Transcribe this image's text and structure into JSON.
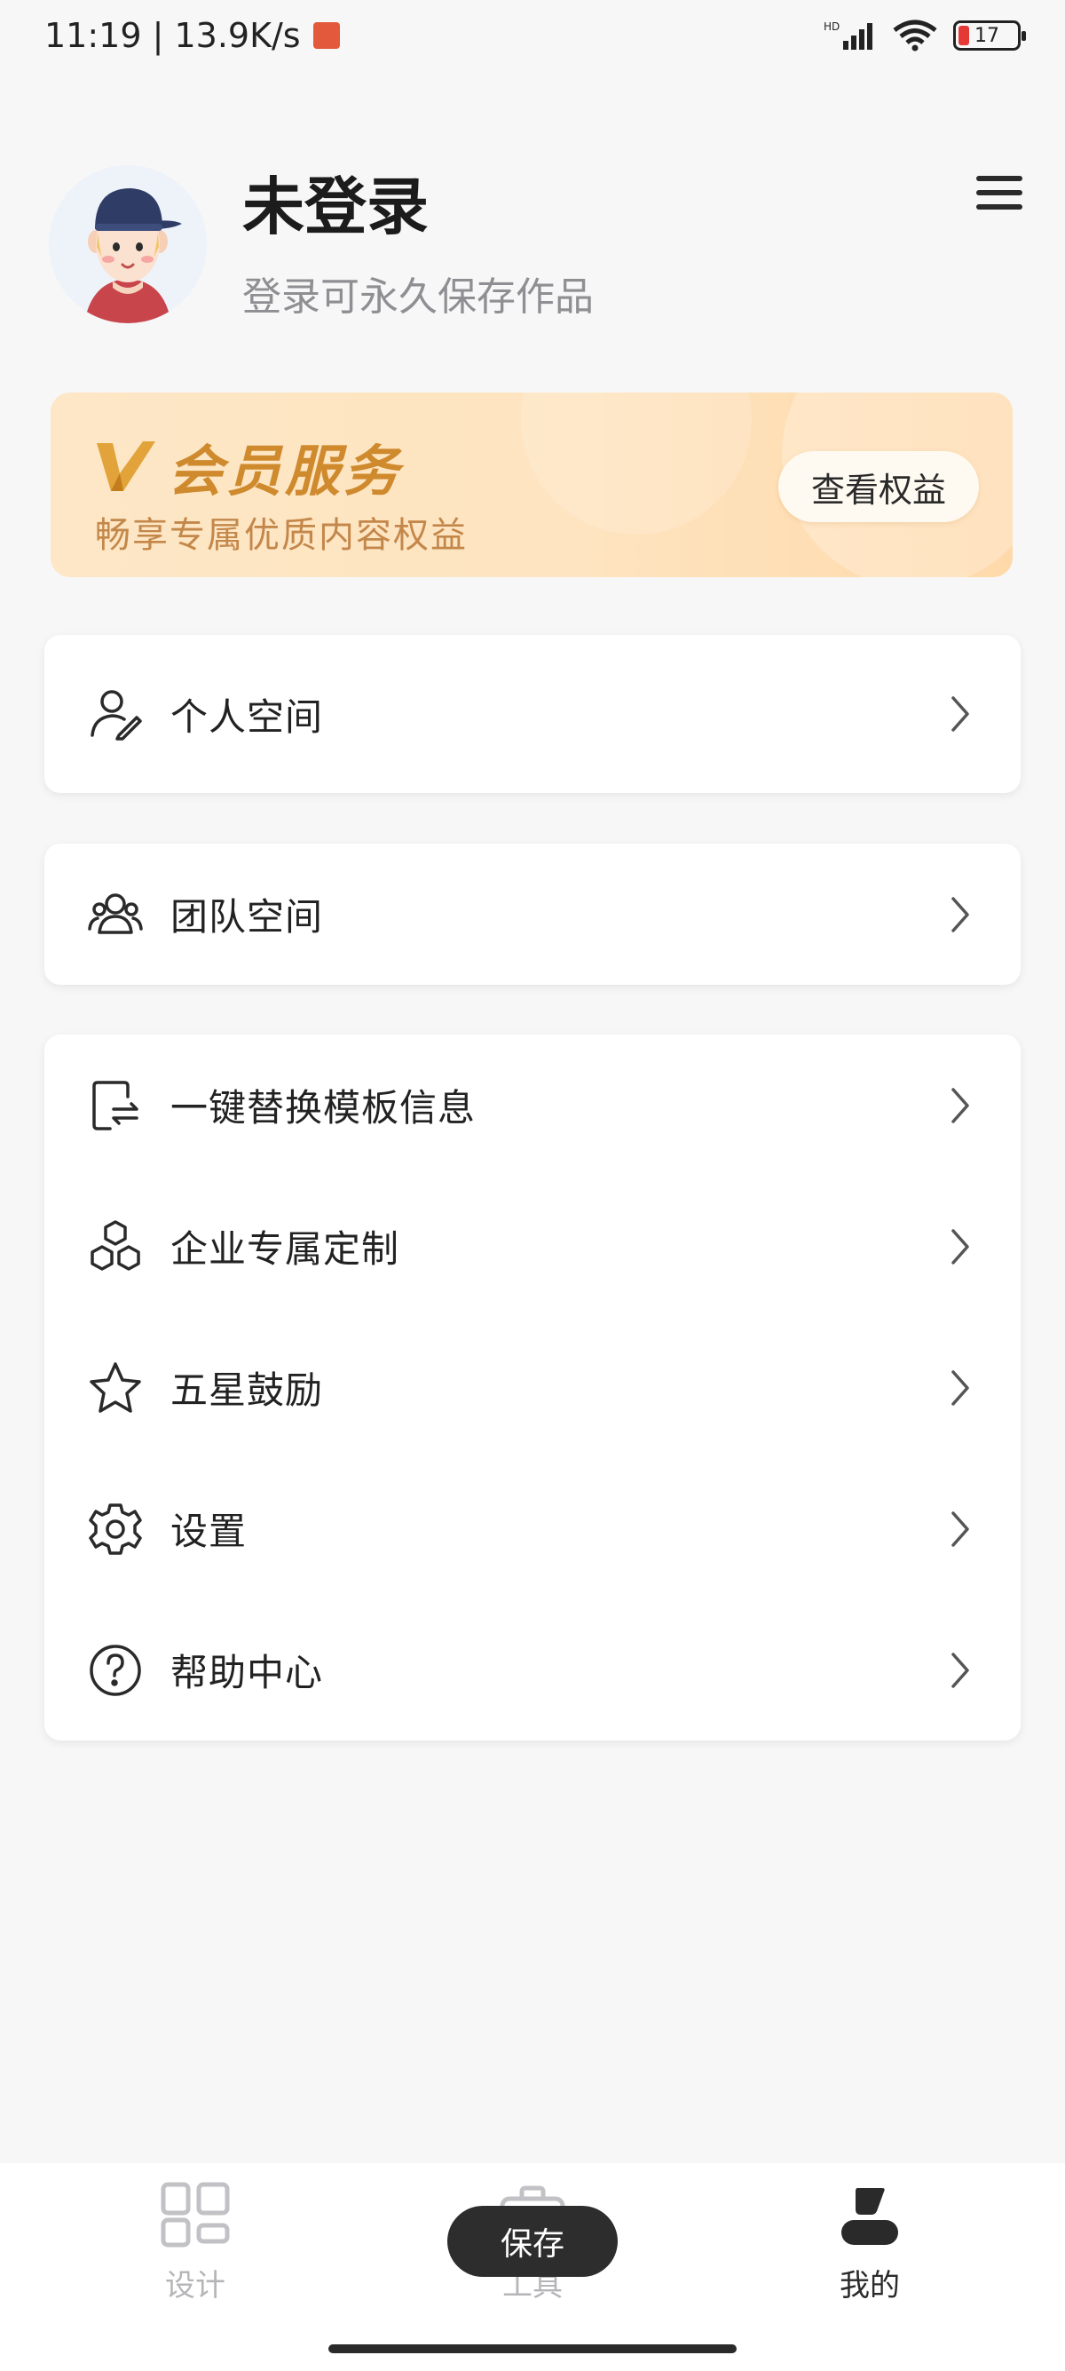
{
  "status_bar": {
    "time_speed": "11:19 | 13.9K/s",
    "battery_level": "17"
  },
  "profile": {
    "name": "未登录",
    "subtitle": "登录可永久保存作品"
  },
  "vip": {
    "title": "会员服务",
    "subtitle": "畅享专属优质内容权益",
    "button_label": "查看权益"
  },
  "menu": {
    "personal_space": "个人空间",
    "team_space": "团队空间",
    "replace_template": "一键替换模板信息",
    "enterprise_custom": "企业专属定制",
    "five_star": "五星鼓励",
    "settings": "设置",
    "help_center": "帮助中心"
  },
  "bottom_nav": {
    "design": "设计",
    "tools": "工具",
    "mine": "我的",
    "save_label": "保存"
  },
  "colors": {
    "accent_gold": "#cf8a2e",
    "vip_bg": "#fde7c6",
    "active_nav": "#2a2a2a",
    "inactive_nav": "#b5b5b8"
  }
}
